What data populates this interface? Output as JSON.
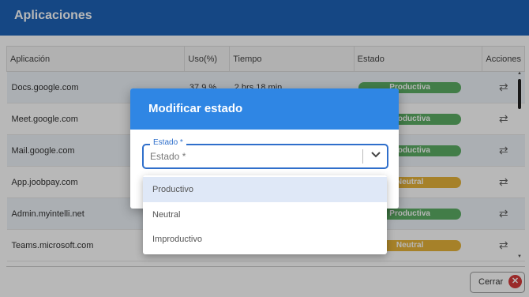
{
  "header": {
    "title": "Aplicaciones"
  },
  "table": {
    "columns": [
      "Aplicación",
      "Uso(%)",
      "Tiempo",
      "Estado",
      "Acciones"
    ],
    "rows": [
      {
        "app": "Docs.google.com",
        "uso": "37.9 %",
        "tiempo": "2 hrs 18 min",
        "estado": "Productiva",
        "color": "#5cae64"
      },
      {
        "app": "Meet.google.com",
        "uso": "",
        "tiempo": "",
        "estado": "Productiva",
        "color": "#5cae64"
      },
      {
        "app": "Mail.google.com",
        "uso": "",
        "tiempo": "",
        "estado": "Productiva",
        "color": "#5cae64"
      },
      {
        "app": "App.joobpay.com",
        "uso": "",
        "tiempo": "",
        "estado": "Neutral",
        "color": "#e6b339"
      },
      {
        "app": "Admin.myintelli.net",
        "uso": "",
        "tiempo": "",
        "estado": "Productiva",
        "color": "#5cae64"
      },
      {
        "app": "Teams.microsoft.com",
        "uso": "",
        "tiempo": "",
        "estado": "Neutral",
        "color": "#e6b339"
      }
    ],
    "action_icon": "swap-arrows-icon"
  },
  "footer": {
    "close_label": "Cerrar"
  },
  "dialog": {
    "title": "Modificar estado",
    "field_label": "Estado *",
    "field_value": "Estado *"
  },
  "dropdown": {
    "options": [
      "Productivo",
      "Neutral",
      "Improductivo"
    ],
    "highlighted": "Productivo"
  }
}
